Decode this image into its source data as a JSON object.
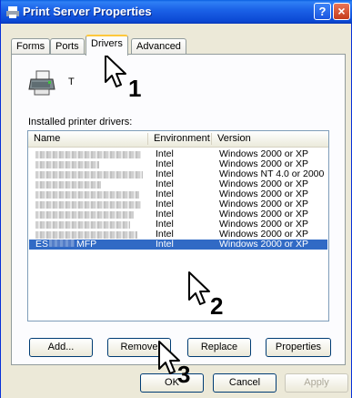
{
  "window": {
    "title": "Print Server Properties",
    "help_label": "?",
    "close_label": "×"
  },
  "tabs": [
    {
      "label": "Forms"
    },
    {
      "label": "Ports"
    },
    {
      "label": "Drivers"
    },
    {
      "label": "Advanced"
    }
  ],
  "server": {
    "name": "T"
  },
  "drivers_list": {
    "label": "Installed printer drivers:",
    "columns": [
      "Name",
      "Environment",
      "Version"
    ],
    "rows": [
      {
        "name": "",
        "environment": "Intel",
        "version": "Windows 2000 or XP"
      },
      {
        "name": "",
        "environment": "Intel",
        "version": "Windows 2000 or XP"
      },
      {
        "name": "",
        "environment": "Intel",
        "version": "Windows NT 4.0 or 2000"
      },
      {
        "name": "",
        "environment": "Intel",
        "version": "Windows 2000 or XP"
      },
      {
        "name": "",
        "environment": "Intel",
        "version": "Windows 2000 or XP"
      },
      {
        "name": "",
        "environment": "Intel",
        "version": "Windows 2000 or XP"
      },
      {
        "name": "",
        "environment": "Intel",
        "version": "Windows 2000 or XP"
      },
      {
        "name": "",
        "environment": "Intel",
        "version": "Windows 2000 or XP"
      },
      {
        "name": "",
        "environment": "Intel",
        "version": "Windows 2000 or XP"
      },
      {
        "name_prefix": "ES",
        "name_suffix": "MFP",
        "environment": "Intel",
        "version": "Windows 2000 or XP",
        "selected": true
      }
    ]
  },
  "buttons": {
    "add": "Add...",
    "remove": "Remove",
    "replace": "Replace",
    "properties": "Properties",
    "ok": "OK",
    "cancel": "Cancel",
    "apply": "Apply"
  },
  "callouts": {
    "step1": "1",
    "step2": "2",
    "step3": "3"
  },
  "colors": {
    "titlebar": "#0b48d3",
    "selection": "#316ac5",
    "tab_highlight": "#ffc83c"
  }
}
